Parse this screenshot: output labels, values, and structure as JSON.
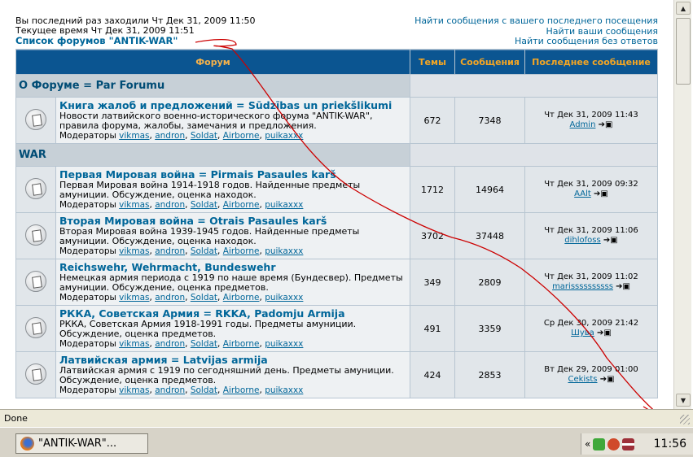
{
  "top": {
    "last_visit": "Вы последний раз заходили Чт Дек 31, 2009 11:50",
    "current_time": "Текущее время Чт Дек 31, 2009 11:51",
    "forum_list_link": "Список форумов \"ANTIK-WAR\"",
    "links": [
      "Найти сообщения с вашего последнего посещения",
      "Найти ваши сообщения",
      "Найти сообщения без ответов"
    ]
  },
  "table": {
    "headers": [
      "Форум",
      "Темы",
      "Сообщения",
      "Последнее сообщение"
    ],
    "moderators_label": "Модераторы",
    "moderators": [
      "vikmas",
      "andron",
      "Soldat",
      "Airborne",
      "puikaxxx"
    ],
    "categories": [
      {
        "name": "O Форуме = Par Forumu",
        "forums": [
          {
            "title": "Книга жалоб и предложений = Sūdzības un priekšlikumi",
            "desc": "Новости латвийского военно-исторического форума \"ANTIK-WAR\", правила форума, жалобы, замечания и предложения.",
            "topics": "672",
            "posts": "7348",
            "last_date": "Чт Дек 31, 2009 11:43",
            "last_user": "Admin"
          }
        ]
      },
      {
        "name": "WAR",
        "forums": [
          {
            "title": "Первая Мировая война = Pirmais Pasaules karš",
            "desc": "Первая Мировая война 1914-1918 годов. Найденные предметы амуниции. Обсуждение, оценка находок.",
            "topics": "1712",
            "posts": "14964",
            "last_date": "Чт Дек 31, 2009 09:32",
            "last_user": "AAlt"
          },
          {
            "title": "Вторая Мировая война = Otrais Pasaules karš",
            "desc": "Вторая Мировая война 1939-1945 годов. Найденные предметы амуниции. Обсуждение, оценка находок.",
            "topics": "3702",
            "posts": "37448",
            "last_date": "Чт Дек 31, 2009 11:06",
            "last_user": "dihlofoss"
          },
          {
            "title": "Reichswehr, Wehrmacht, Bundeswehr",
            "desc": "Немецкая армия периода с 1919 по наше время (Бундесвер). Предметы амуниции. Обсуждение, оценка предметов.",
            "topics": "349",
            "posts": "2809",
            "last_date": "Чт Дек 31, 2009 11:02",
            "last_user": "marissssssssss"
          },
          {
            "title": "РККА, Советская Армия = RKKA, Padomju Armija",
            "desc": "РККА, Советская Армия 1918-1991 годы. Предметы амуниции. Обсуждение, оценка предметов.",
            "topics": "491",
            "posts": "3359",
            "last_date": "Ср Дек 30, 2009 21:42",
            "last_user": "Шува"
          },
          {
            "title": "Латвийская армия = Latvijas armija",
            "desc": "Латвийская армия с 1919 по сегодняшний день. Предметы амуниции. Обсуждение, оценка предметов.",
            "topics": "424",
            "posts": "2853",
            "last_date": "Вт Дек 29, 2009 01:00",
            "last_user": "Cekists"
          }
        ]
      }
    ]
  },
  "statusbar": {
    "text": "Done"
  },
  "taskbar": {
    "task_label": "\"ANTIK-WAR\"...",
    "clock": "11:56",
    "chevron": "«"
  },
  "colors": {
    "header_bg": "#0b5591",
    "header_text": "#f5a623",
    "link": "#006699",
    "annotation_line": "#cc0000"
  }
}
